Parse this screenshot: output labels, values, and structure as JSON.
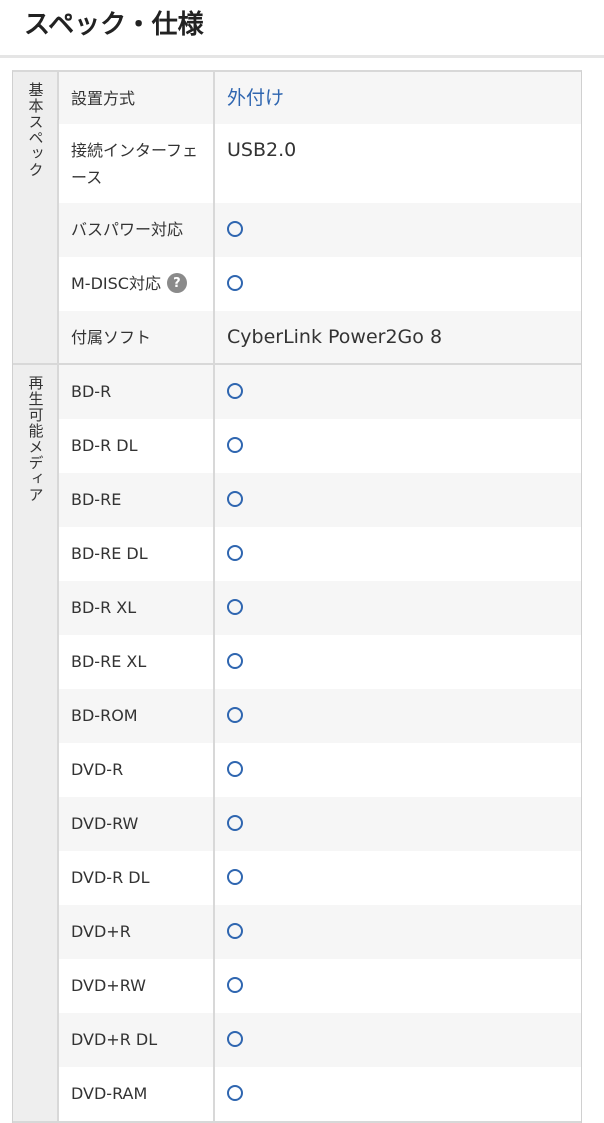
{
  "header": {
    "title": "スペック・仕様"
  },
  "groups": [
    {
      "label": "基本スペック",
      "rows": [
        {
          "key": "設置方式",
          "value": "外付け",
          "value_style": "link"
        },
        {
          "key": "接続インターフェース",
          "value": "USB2.0",
          "value_style": "text"
        },
        {
          "key": "バスパワー対応",
          "value": "○",
          "value_style": "circle"
        },
        {
          "key": "M-DISC対応",
          "value": "○",
          "value_style": "circle",
          "help_icon": "?"
        },
        {
          "key": "付属ソフト",
          "value": "CyberLink Power2Go 8",
          "value_style": "text"
        }
      ]
    },
    {
      "label": "再生可能メディア",
      "rows": [
        {
          "key": "BD-R",
          "value": "○",
          "value_style": "circle"
        },
        {
          "key": "BD-R DL",
          "value": "○",
          "value_style": "circle"
        },
        {
          "key": "BD-RE",
          "value": "○",
          "value_style": "circle"
        },
        {
          "key": "BD-RE DL",
          "value": "○",
          "value_style": "circle"
        },
        {
          "key": "BD-R XL",
          "value": "○",
          "value_style": "circle"
        },
        {
          "key": "BD-RE XL",
          "value": "○",
          "value_style": "circle"
        },
        {
          "key": "BD-ROM",
          "value": "○",
          "value_style": "circle"
        },
        {
          "key": "DVD-R",
          "value": "○",
          "value_style": "circle"
        },
        {
          "key": "DVD-RW",
          "value": "○",
          "value_style": "circle"
        },
        {
          "key": "DVD-R DL",
          "value": "○",
          "value_style": "circle"
        },
        {
          "key": "DVD+R",
          "value": "○",
          "value_style": "circle"
        },
        {
          "key": "DVD+RW",
          "value": "○",
          "value_style": "circle"
        },
        {
          "key": "DVD+R DL",
          "value": "○",
          "value_style": "circle"
        },
        {
          "key": "DVD-RAM",
          "value": "○",
          "value_style": "circle"
        }
      ]
    }
  ],
  "colors": {
    "link": "#2f66b0",
    "label_bg": "#eeeeee",
    "row_alt_bg": "#f6f6f6",
    "border": "#d8d8d8",
    "help_icon_bg": "#8a8a8a"
  }
}
